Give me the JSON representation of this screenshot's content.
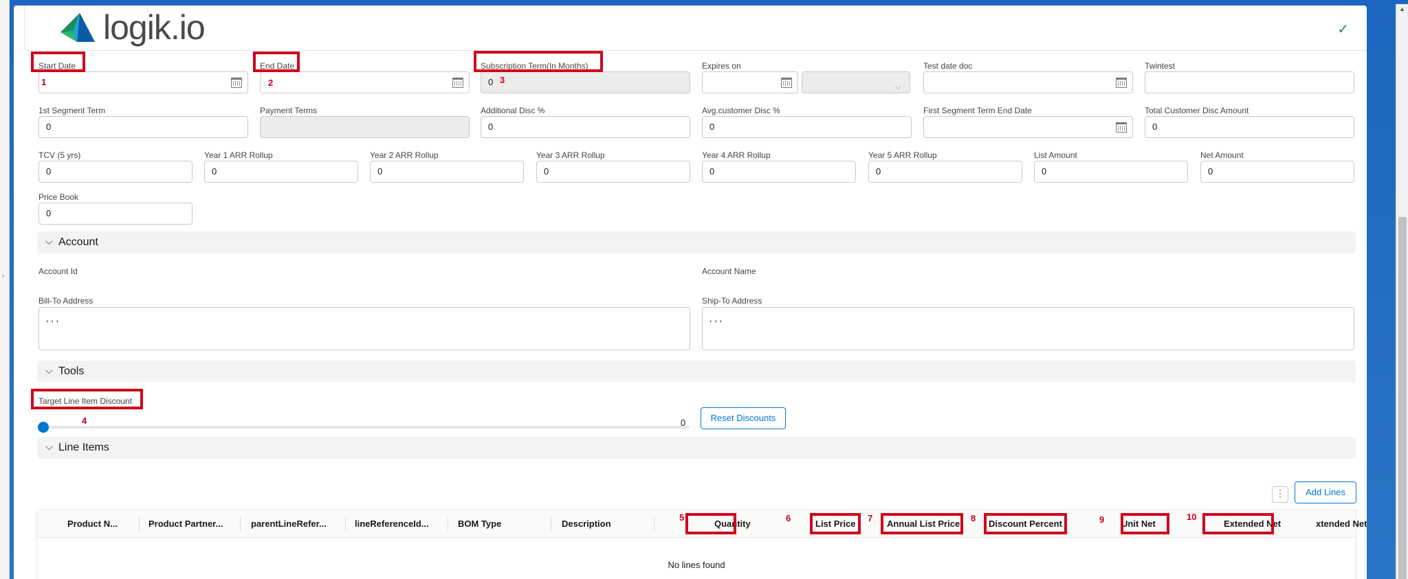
{
  "app": {
    "logo_text": "logik.io",
    "status_icon": "checkmark-icon"
  },
  "fields_row1": [
    {
      "label": "Start Date",
      "value": "",
      "marker": "1"
    },
    {
      "label": "End Date",
      "value": "",
      "marker": "2"
    },
    {
      "label": "Subscription Term(In Months)",
      "value": "0",
      "marker": "3"
    },
    {
      "label": "Expires on",
      "value": ""
    },
    {
      "label": "Test date doc",
      "value": ""
    },
    {
      "label": "Twintest",
      "value": ""
    }
  ],
  "fields_row2": [
    {
      "label": "1st Segment Term",
      "value": "0"
    },
    {
      "label": "Payment Terms",
      "value": ""
    },
    {
      "label": "Additional Disc %",
      "value": "0"
    },
    {
      "label": "Avg.customer Disc %",
      "value": "0"
    },
    {
      "label": "First Segment Term End Date",
      "value": ""
    },
    {
      "label": "Total Customer Disc Amount",
      "value": "0"
    }
  ],
  "fields_row3": [
    {
      "label": "TCV (5 yrs)",
      "value": "0"
    },
    {
      "label": "Year 1 ARR Rollup",
      "value": "0"
    },
    {
      "label": "Year 2 ARR Rollup",
      "value": "0"
    },
    {
      "label": "Year 3 ARR Rollup",
      "value": "0"
    },
    {
      "label": "Year 4 ARR Rollup",
      "value": "0"
    },
    {
      "label": "Year 5 ARR Rollup",
      "value": "0"
    },
    {
      "label": "List Amount",
      "value": "0"
    },
    {
      "label": "Net Amount",
      "value": "0"
    }
  ],
  "price_book": {
    "label": "Price Book",
    "value": "0"
  },
  "account": {
    "section_title": "Account",
    "account_id_label": "Account Id",
    "account_name_label": "Account Name",
    "bill_to_label": "Bill-To Address",
    "bill_to_value": ", , ,",
    "ship_to_label": "Ship-To Address",
    "ship_to_value": ", , ,"
  },
  "tools": {
    "section_title": "Tools",
    "discount_label": "Target Line Item Discount",
    "slider_value": "0",
    "slider_level": 0,
    "marker": "4",
    "reset_button": "Reset Discounts"
  },
  "line_items": {
    "section_title": "Line Items",
    "add_lines_button": "Add Lines",
    "columns": [
      {
        "label": "Product N..."
      },
      {
        "label": "Product Partner..."
      },
      {
        "label": "parentLineRefer..."
      },
      {
        "label": "lineReferenceId..."
      },
      {
        "label": "BOM Type"
      },
      {
        "label": "Description"
      },
      {
        "label": "Quantity",
        "marker": "5"
      },
      {
        "label": "List Price",
        "marker": "6"
      },
      {
        "label": "Annual List Price",
        "marker": "7"
      },
      {
        "label": "Discount Percent",
        "marker": "8"
      },
      {
        "label": "Unit Net",
        "marker": "9"
      },
      {
        "label": "Extended Net",
        "marker": "10"
      },
      {
        "label": "xtended Net Pr"
      }
    ],
    "empty_text": "No lines found"
  },
  "colors": {
    "highlight": "#d0021b",
    "accent": "#0176d3",
    "success": "#2e844a"
  }
}
